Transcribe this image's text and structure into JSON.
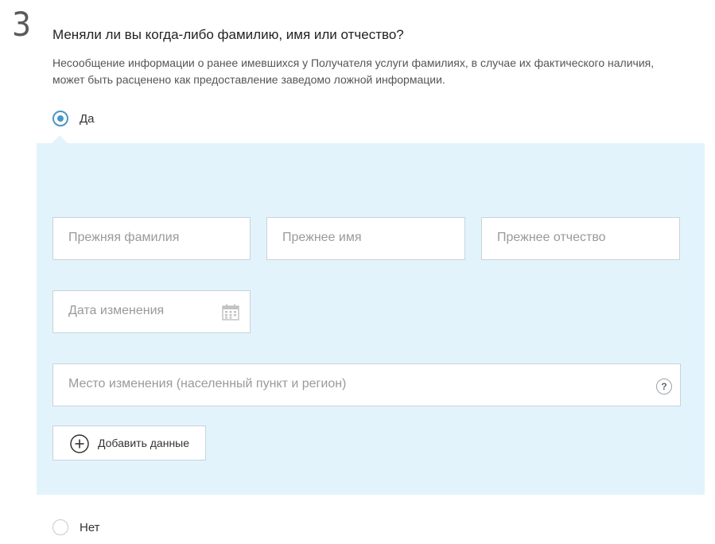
{
  "question": {
    "number": "3",
    "title": "Меняли ли вы когда-либо фамилию, имя или отчество?",
    "hint": "Несообщение информации о ранее имевшихся у Получателя услуги фамилиях, в случае их фактического наличия, может быть расценено как предоставление заведомо ложной информации."
  },
  "options": {
    "yes": {
      "label": "Да",
      "selected": true
    },
    "no": {
      "label": "Нет",
      "selected": false
    }
  },
  "form": {
    "previous_surname": {
      "placeholder": "Прежняя фамилия",
      "value": ""
    },
    "previous_name": {
      "placeholder": "Прежнее имя",
      "value": ""
    },
    "previous_patronymic": {
      "placeholder": "Прежнее отчество",
      "value": ""
    },
    "change_date": {
      "placeholder": "Дата изменения",
      "value": "",
      "icon": "calendar-icon"
    },
    "change_place": {
      "placeholder": "Место изменения (населенный пункт и регион)",
      "value": "",
      "help_icon": "?"
    },
    "add_button_label": "Добавить данные"
  },
  "colors": {
    "accent": "#4a97c7",
    "panel_background": "#e3f3fc",
    "field_border": "#c7d3da"
  }
}
